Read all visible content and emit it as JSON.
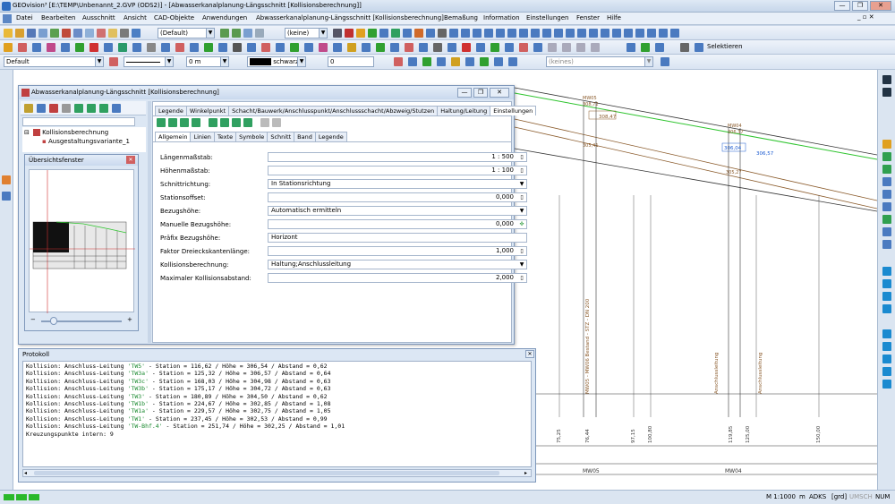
{
  "window": {
    "title": "GEOvision³ [E:\\TEMP\\Unbenannt_2.GVP (ODS2)] - [Abwasserkanalplanung-Längsschnitt [Kollisionsberechnung]]",
    "min": "—",
    "restore": "❐",
    "close": "✕"
  },
  "menu": [
    "Datei",
    "Bearbeiten",
    "Ausschnitt",
    "Ansicht",
    "CAD-Objekte",
    "Anwendungen",
    "Abwasserkanalplanung-Längsschnitt [Kollisionsberechnung]",
    "Bemaßung",
    "Information",
    "Einstellungen",
    "Fenster",
    "Hilfe"
  ],
  "toolbar1": {
    "combo_default": "(Default)",
    "combo_keine": "(keine)"
  },
  "toolbar2": {
    "select_label": "Selektieren"
  },
  "toolbar3": {
    "layer": "Default",
    "width": "0 m",
    "color": "schwarz",
    "number": "0",
    "keine": "(keines)"
  },
  "dialog": {
    "title": "Abwasserkanalplanung-Längsschnitt [Kollisionsberechnung]",
    "tree": {
      "root": "Kollisionsberechnung",
      "child": "Ausgestaltungsvariante_1"
    },
    "overview_title": "Übersichtsfenster",
    "tabs1": [
      "Legende",
      "Winkelpunkt",
      "Schacht/Bauwerk/Anschlusspunkt/Anschlussschacht/Abzweig/Stutzen",
      "Haltung/Leitung",
      "Einstellungen"
    ],
    "tabs2": [
      "Allgemein",
      "Linien",
      "Texte",
      "Symbole",
      "Schnitt",
      "Band",
      "Legende"
    ],
    "fields": [
      {
        "label": "Längenmaßstab:",
        "value": "1 : 500",
        "kind": "spin"
      },
      {
        "label": "Höhenmaßstab:",
        "value": "1 : 100",
        "kind": "spin"
      },
      {
        "label": "Schnittrichtung:",
        "value": "In Stationsrichtung",
        "kind": "drop"
      },
      {
        "label": "Stationsoffset:",
        "value": "0,000",
        "kind": "spin"
      },
      {
        "label": "Bezugshöhe:",
        "value": "Automatisch ermitteln",
        "kind": "drop"
      },
      {
        "label": "Manuelle Bezugshöhe:",
        "value": "0,000",
        "kind": "spin"
      },
      {
        "label": "Präfix Bezugshöhe:",
        "value": "Horizont",
        "kind": "text"
      },
      {
        "label": "Faktor Dreieckskantenlänge:",
        "value": "1,000",
        "kind": "spin"
      },
      {
        "label": "Kollisionsberechnung:",
        "value": "Haltung;Anschlussleitung",
        "kind": "drop"
      },
      {
        "label": "Maximaler Kollisionsabstand:",
        "value": "2,000",
        "kind": "spin"
      }
    ]
  },
  "protocol": {
    "title": "Protokoll",
    "lines": [
      {
        "a": "Kollision: Anschluss-Leitung ",
        "s": "'TW5'",
        "b": " - Station = 116,62 / Höhe = 306,54 / Abstand = 0,62"
      },
      {
        "a": "Kollision: Anschluss-Leitung ",
        "s": "'TW3a'",
        "b": " - Station = 125,32 / Höhe = 306,57 / Abstand = 0,64"
      },
      {
        "a": "Kollision: Anschluss-Leitung ",
        "s": "'TW3c'",
        "b": " - Station = 168,03 / Höhe = 304,98 / Abstand = 0,63"
      },
      {
        "a": "Kollision: Anschluss-Leitung ",
        "s": "'TW3b'",
        "b": " - Station = 175,17 / Höhe = 304,72 / Abstand = 0,63"
      },
      {
        "a": "Kollision: Anschluss-Leitung ",
        "s": "'TW3'",
        "b": " - Station = 180,89 / Höhe = 304,50 / Abstand = 0,62"
      },
      {
        "a": "Kollision: Anschluss-Leitung ",
        "s": "'TW1b'",
        "b": " - Station = 224,67 / Höhe = 302,85 / Abstand = 1,08"
      },
      {
        "a": "Kollision: Anschluss-Leitung ",
        "s": "'TW1a'",
        "b": " - Station = 229,57 / Höhe = 302,75 / Abstand = 1,05"
      },
      {
        "a": "Kollision: Anschluss-Leitung ",
        "s": "'TW1'",
        "b": " - Station = 237,45 / Höhe = 302,53 / Abstand = 0,99"
      },
      {
        "a": "Kollision: Anschluss-Leitung ",
        "s": "'TW-Bhf.4'",
        "b": " - Station = 251,74 / Höhe = 302,25 / Abstand = 1,01"
      },
      {
        "a": "Kreuzungspunkte intern: 9",
        "s": "",
        "b": ""
      }
    ]
  },
  "drawing": {
    "labels": {
      "mw05": "MW05",
      "mw04": "MW04",
      "v1": "308,47",
      "v2": "308,72",
      "v3": "305,41",
      "v4": "306,57",
      "v5": "306,04",
      "v6": "305,27",
      "v7": "306,37",
      "mw05_vert": "MW05 - MW06 Bestand - STZ - DN 200",
      "l1": "Anschlussleitung",
      "l2": "Anschlussleitung"
    },
    "stations": [
      "75,25",
      "76,44",
      "97,15",
      "100,80",
      "119,85",
      "125,00",
      "150,00"
    ]
  },
  "status": {
    "scale": "M 1:1000",
    "unit": "m",
    "a1": "ADKS",
    "a2": "[grd]",
    "a3": "UMSCH",
    "a4": "NUM"
  }
}
